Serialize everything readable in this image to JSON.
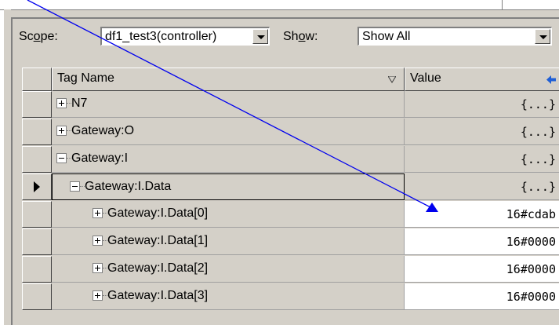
{
  "scope": {
    "label": "Scope:",
    "value": "df1_test3(controller)"
  },
  "show": {
    "label": "Show:",
    "value": "Show All"
  },
  "columns": {
    "tag_name": "Tag Name",
    "value": "Value",
    "next": "F"
  },
  "rows": [
    {
      "name": "N7",
      "value": "{...}",
      "expand": "plus"
    },
    {
      "name": "Gateway:O",
      "value": "{...}",
      "expand": "plus"
    },
    {
      "name": "Gateway:I",
      "value": "{...}",
      "expand": "minus"
    },
    {
      "name": "Gateway:I.Data",
      "value": "{...}",
      "expand": "minus"
    },
    {
      "name": "Gateway:I.Data[0]",
      "value": "16#cdab",
      "expand": "plus"
    },
    {
      "name": "Gateway:I.Data[1]",
      "value": "16#0000",
      "expand": "plus"
    },
    {
      "name": "Gateway:I.Data[2]",
      "value": "16#0000",
      "expand": "plus"
    },
    {
      "name": "Gateway:I.Data[3]",
      "value": "16#0000",
      "expand": "plus"
    }
  ],
  "colors": {
    "arrow": "#0000ee",
    "panel": "#d4d0c8",
    "sort_arrow": "#1f5fd6"
  }
}
